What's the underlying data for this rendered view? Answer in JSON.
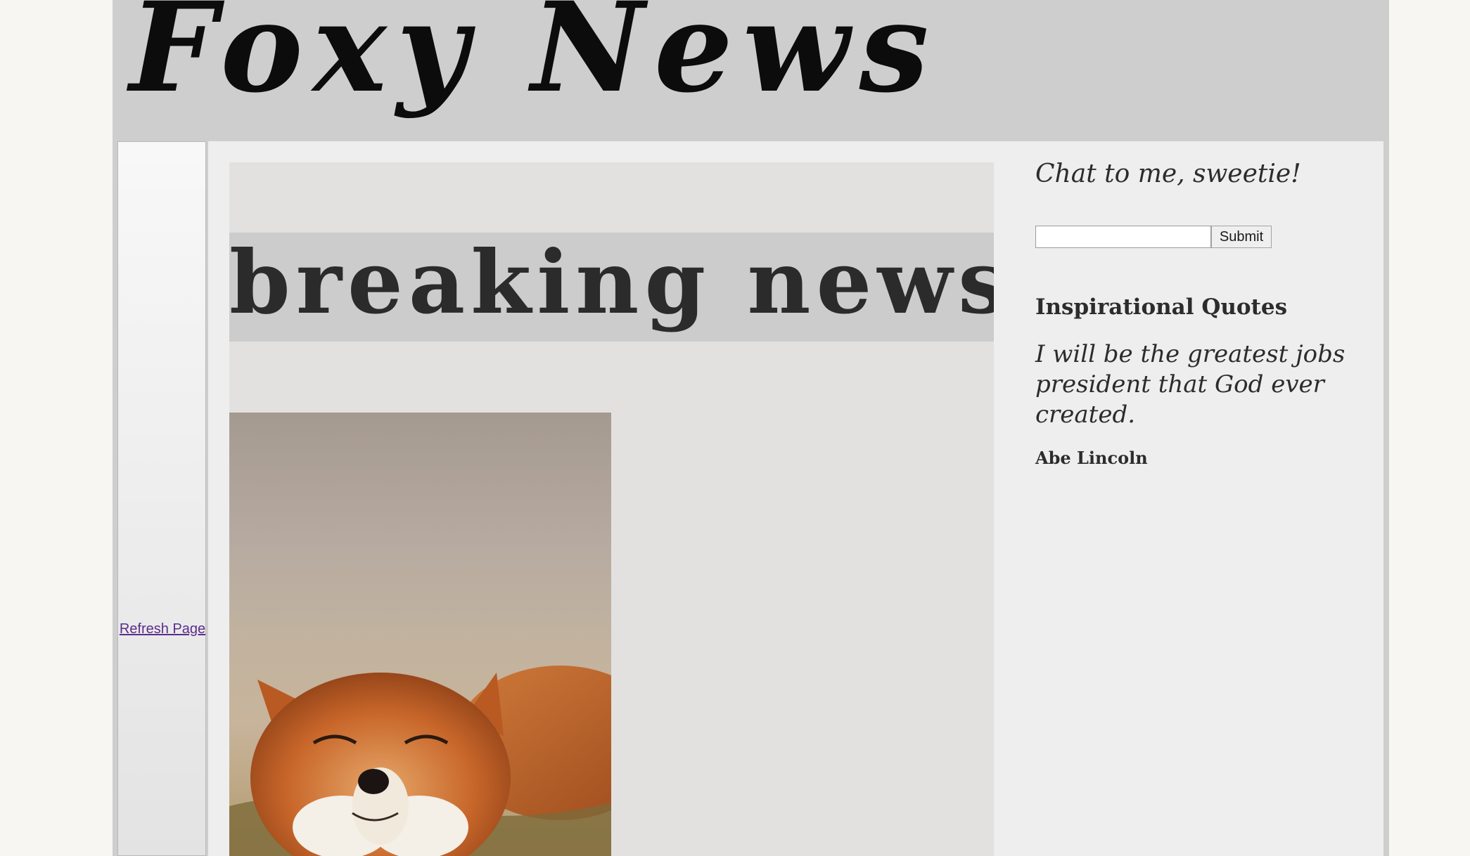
{
  "header": {
    "site_title": "Foxy News"
  },
  "leftnav": {
    "refresh_link": "Refresh Page"
  },
  "main": {
    "breaking_banner": "breaking news",
    "image_subject": "smiling-red-fox"
  },
  "sidebar": {
    "chat_heading": "Chat to me, sweetie!",
    "chat_input_value": "",
    "submit_label": "Submit",
    "quotes_heading": "Inspirational Quotes",
    "quote_text": "I will be the greatest jobs president that God ever created.",
    "quote_author": "Abe Lincoln"
  },
  "colors": {
    "page_background": "#f7f6f3",
    "masthead_background": "#cecece",
    "content_background": "#eeeeee",
    "main_column_background": "#e2e1e0",
    "banner_background": "#cccccc",
    "link_color": "#5c2d8c",
    "fox_fur": "#c8662a"
  }
}
